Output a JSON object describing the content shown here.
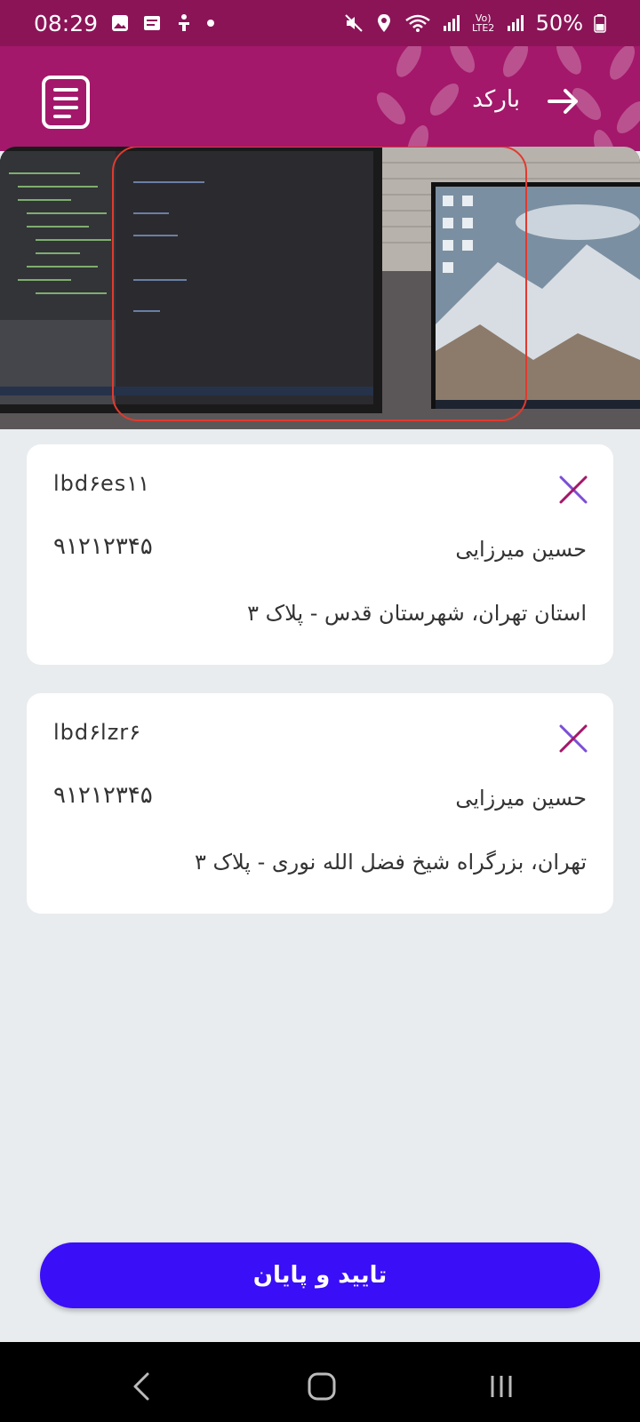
{
  "status_bar": {
    "time": "08:29",
    "battery": "50%",
    "network": "Vo) LTE2"
  },
  "header": {
    "title": "بارکد"
  },
  "orders": [
    {
      "code": "lbd۶es۱۱",
      "phone": "۹۱۲۱۲۳۴۵",
      "name": "حسین میرزایی",
      "address": "استان تهران، شهرستان قدس - پلاک ۳"
    },
    {
      "code": "lbd۶lzr۶",
      "phone": "۹۱۲۱۲۳۴۵",
      "name": "حسین میرزایی",
      "address": "تهران، بزرگراه شیخ فضل الله نوری - پلاک ۳"
    }
  ],
  "confirm_button": "تایید و پایان",
  "colors": {
    "status_bar": "#8b1457",
    "header": "#a3186a",
    "primary_button": "#3a0ef6",
    "close_icon_a": "#7b4fd6",
    "close_icon_b": "#a3186a"
  }
}
